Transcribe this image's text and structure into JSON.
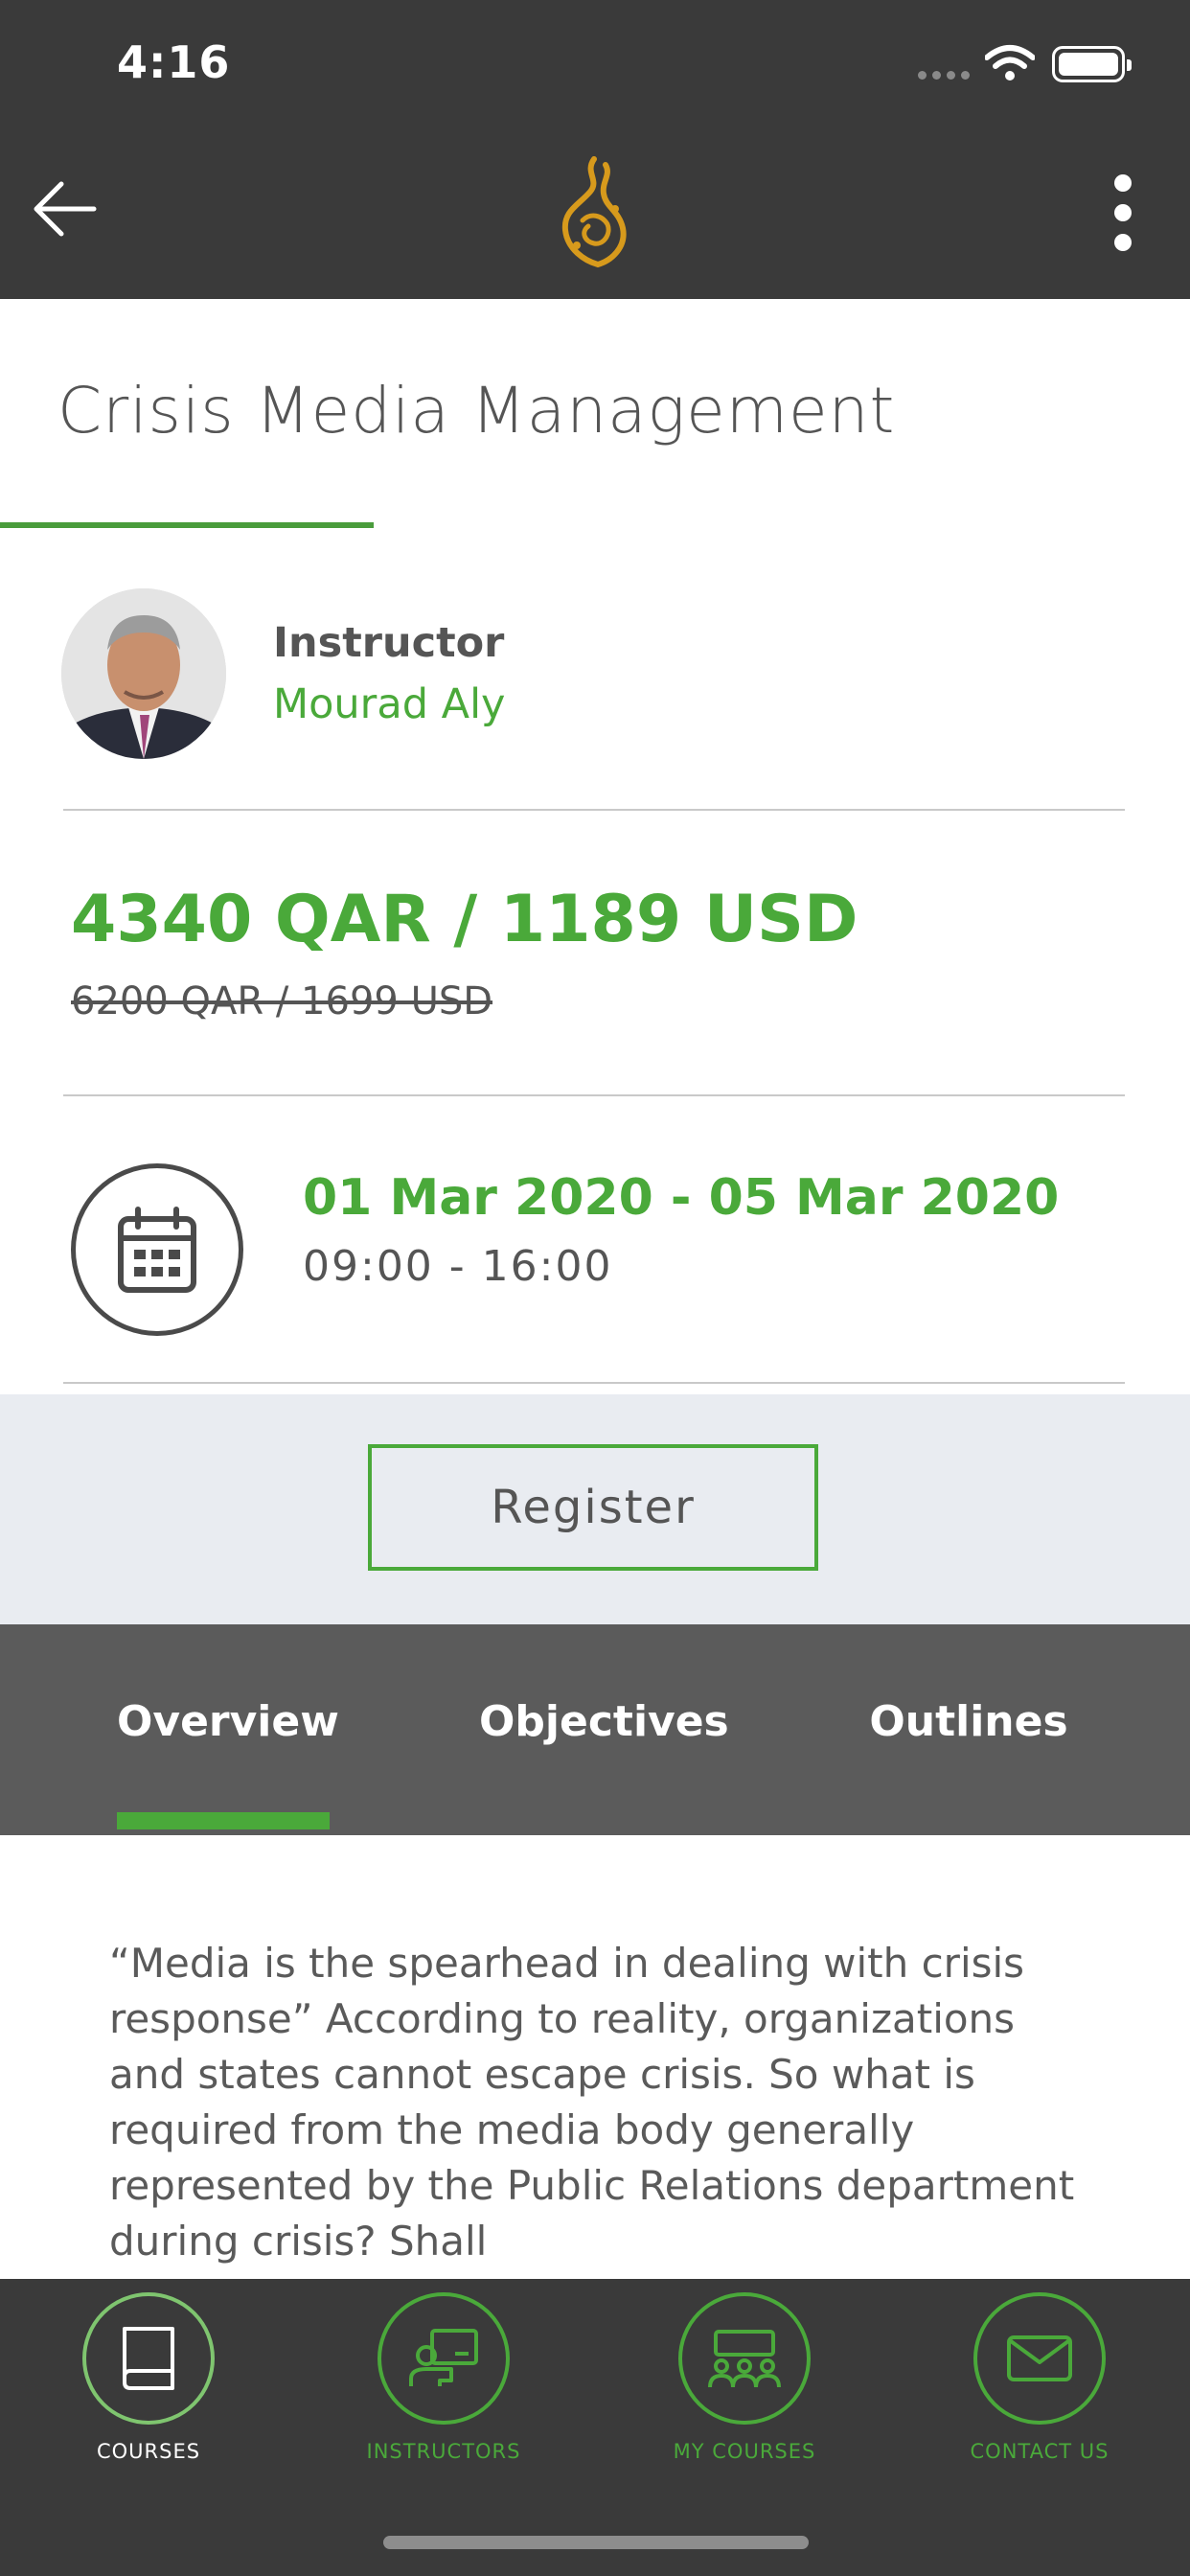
{
  "status_bar": {
    "time": "4:16"
  },
  "course": {
    "title": "Crisis Media Management"
  },
  "instructor": {
    "label": "Instructor",
    "name": "Mourad Aly"
  },
  "price": {
    "current": "4340 QAR / 1189 USD",
    "original": "6200 QAR / 1699 USD"
  },
  "schedule": {
    "dates": "01 Mar 2020 - 05 Mar 2020",
    "hours": "09:00 - 16:00"
  },
  "register": {
    "label": "Register"
  },
  "tabs": [
    {
      "label": "Overview",
      "active": true
    },
    {
      "label": "Objectives",
      "active": false
    },
    {
      "label": "Outlines",
      "active": false
    }
  ],
  "overview": {
    "text": "“Media is the spearhead in dealing with crisis response” According to reality, organizations and states cannot escape crisis. So what is required from the media body generally represented by the Public Relations department during crisis? Shall"
  },
  "bottom_nav": [
    {
      "label": "COURSES",
      "icon": "book-icon",
      "active": true
    },
    {
      "label": "INSTRUCTORS",
      "icon": "instructor-board-icon",
      "active": false
    },
    {
      "label": "MY COURSES",
      "icon": "group-icon",
      "active": false
    },
    {
      "label": "CONTACT US",
      "icon": "envelope-icon",
      "active": false
    }
  ],
  "colors": {
    "accent": "#4aa93a",
    "header": "#3a3a3a",
    "tab_bar": "#5b5b5b",
    "register_bg": "#e9ecf1"
  }
}
